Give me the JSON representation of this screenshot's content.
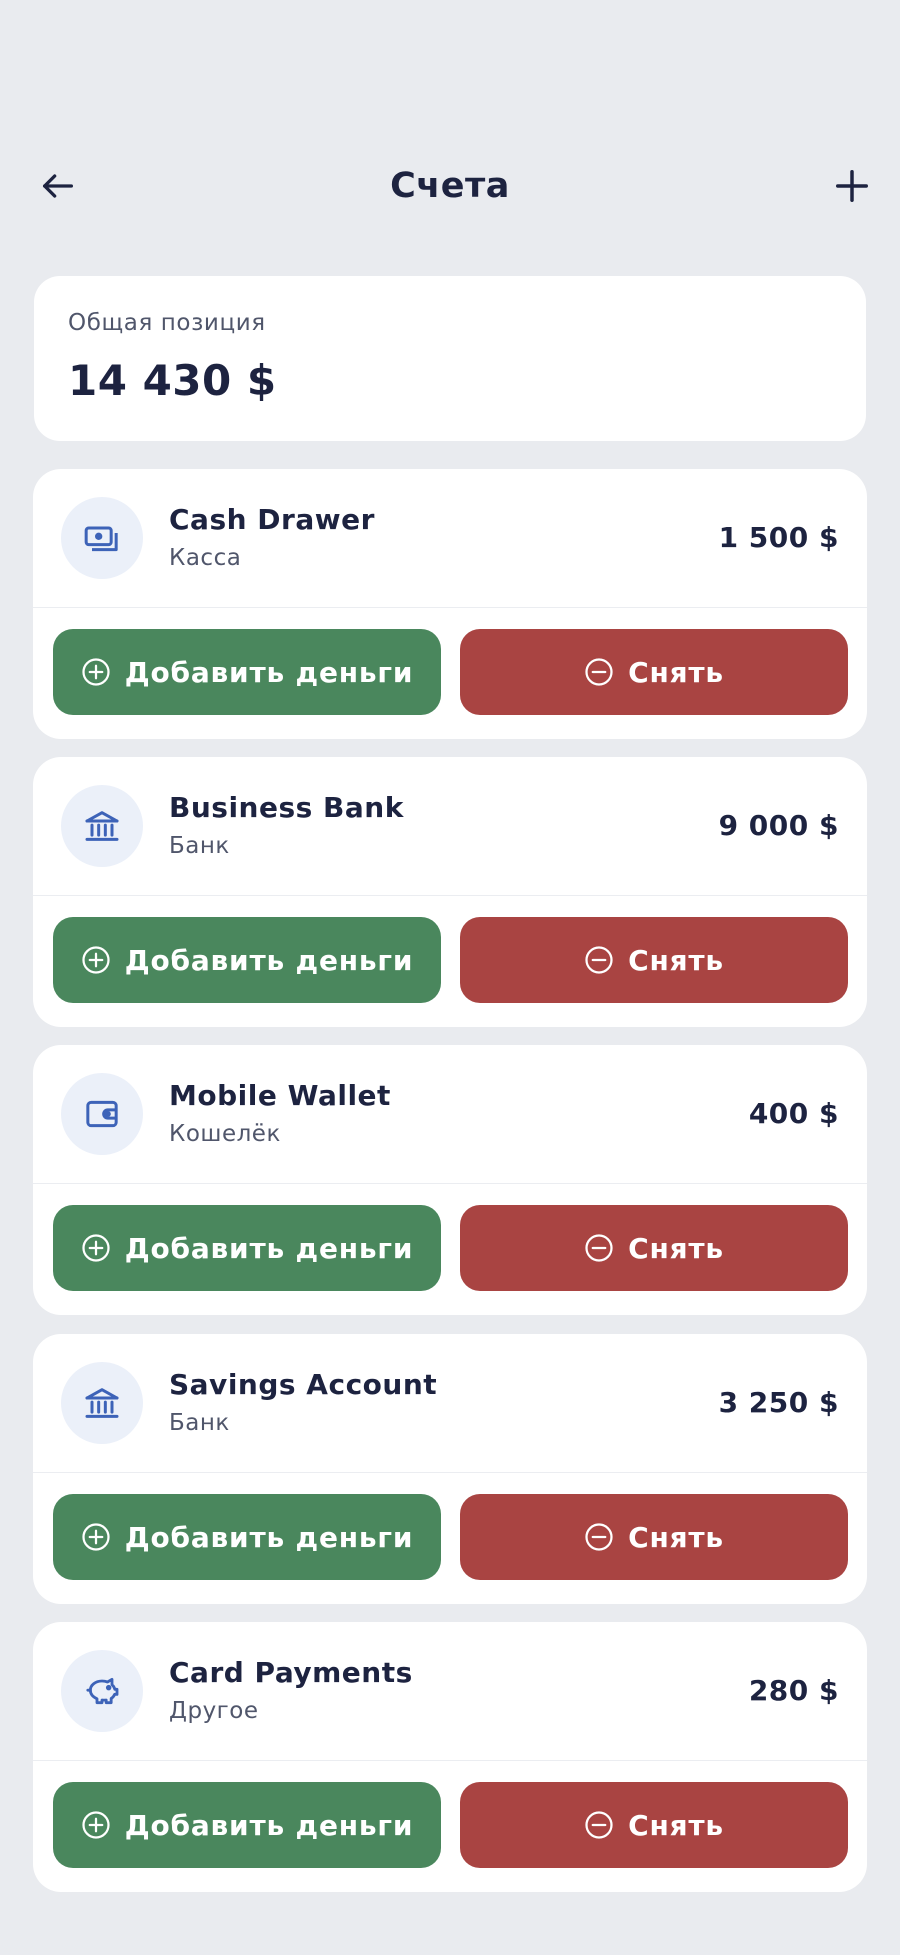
{
  "header": {
    "title": "Счета"
  },
  "total": {
    "label": "Общая позиция",
    "value": "14 430 $"
  },
  "accounts": [
    {
      "name": "Cash Drawer",
      "type": "Касса",
      "amount": "1 500 $",
      "icon": "cash-icon",
      "add_label": "Добавить деньги",
      "withdraw_label": "Снять"
    },
    {
      "name": "Business Bank",
      "type": "Банк",
      "amount": "9 000 $",
      "icon": "bank-icon",
      "add_label": "Добавить деньги",
      "withdraw_label": "Снять"
    },
    {
      "name": "Mobile Wallet",
      "type": "Кошелёк",
      "amount": "400 $",
      "icon": "wallet-icon",
      "add_label": "Добавить деньги",
      "withdraw_label": "Снять"
    },
    {
      "name": "Savings Account",
      "type": "Банк",
      "amount": "3 250 $",
      "icon": "bank-icon",
      "add_label": "Добавить деньги",
      "withdraw_label": "Снять"
    },
    {
      "name": "Card Payments",
      "type": "Другое",
      "amount": "280 $",
      "icon": "piggy-bank-icon",
      "add_label": "Добавить деньги",
      "withdraw_label": "Снять"
    }
  ],
  "colors": {
    "background": "#e9ebef",
    "card": "#ffffff",
    "text_primary": "#1d2340",
    "text_secondary": "#50566b",
    "icon_blue": "#3d63b8",
    "icon_bg": "#ebf0f9",
    "add_green": "#4a875d",
    "withdraw_red": "#a94442"
  }
}
